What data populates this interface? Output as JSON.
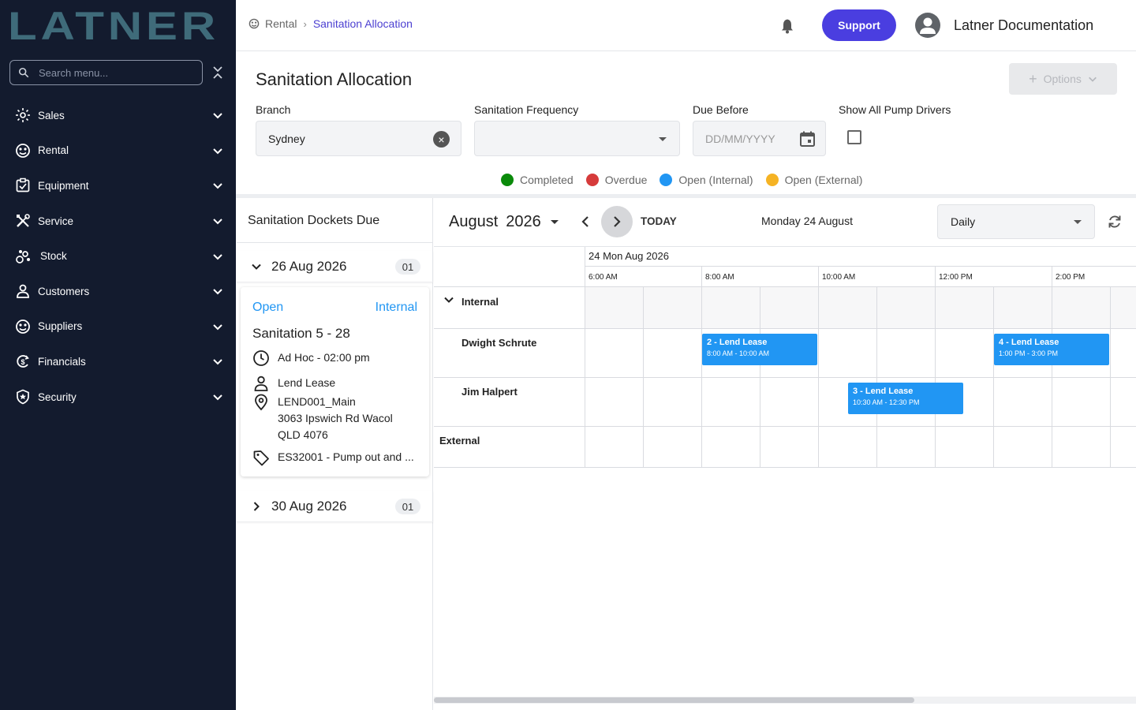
{
  "sidebar": {
    "logo_text": "LATNER",
    "search_placeholder": "Search menu...",
    "items": [
      {
        "label": "Sales",
        "icon": "sales-icon"
      },
      {
        "label": "Rental",
        "icon": "rental-icon"
      },
      {
        "label": "Equipment",
        "icon": "equipment-icon"
      },
      {
        "label": "Service",
        "icon": "service-icon"
      },
      {
        "label": "Stock",
        "icon": "stock-icon"
      },
      {
        "label": "Customers",
        "icon": "customers-icon"
      },
      {
        "label": "Suppliers",
        "icon": "suppliers-icon"
      },
      {
        "label": "Financials",
        "icon": "financials-icon"
      },
      {
        "label": "Security",
        "icon": "security-icon"
      }
    ]
  },
  "header": {
    "breadcrumb": [
      "Rental",
      "Sanitation Allocation"
    ],
    "support_label": "Support",
    "user_name": "Latner Documentation"
  },
  "page": {
    "title": "Sanitation Allocation",
    "options_label": "Options"
  },
  "filters": {
    "branch_label": "Branch",
    "branch_value": "Sydney",
    "frequency_label": "Sanitation Frequency",
    "frequency_value": "",
    "due_before_label": "Due Before",
    "due_before_placeholder": "DD/MM/YYYY",
    "show_all_label": "Show All Pump Drivers",
    "show_all_checked": false
  },
  "legend": [
    {
      "label": "Completed",
      "color": "#0a8a0a"
    },
    {
      "label": "Overdue",
      "color": "#d63b3b"
    },
    {
      "label": "Open (Internal)",
      "color": "#2196f3"
    },
    {
      "label": "Open (External)",
      "color": "#f5b324"
    }
  ],
  "dockets": {
    "title": "Sanitation Dockets Due",
    "groups": [
      {
        "date": "26 Aug 2026",
        "count": "01",
        "expanded": true
      },
      {
        "date": "30 Aug 2026",
        "count": "01",
        "expanded": false
      }
    ],
    "card": {
      "status": "Open",
      "type": "Internal",
      "name": "Sanitation 5 - 28",
      "schedule": "Ad Hoc - 02:00 pm",
      "customer": "Lend Lease",
      "site": "LEND001_Main",
      "address_line1": "3063 Ipswich Rd Wacol",
      "address_line2": "QLD 4076",
      "item": "ES32001 - Pump out and ..."
    }
  },
  "calendar": {
    "month": "August",
    "year": "2026",
    "today_label": "TODAY",
    "current_date": "Monday 24 August",
    "view": "Daily",
    "day_header": "24 Mon Aug 2026",
    "time_labels": [
      "6:00 AM",
      "8:00 AM",
      "10:00 AM",
      "12:00 PM",
      "2:00 PM"
    ],
    "groups": [
      "Internal",
      "External"
    ],
    "resources": [
      "Dwight Schrute",
      "Jim Halpert"
    ],
    "events": [
      {
        "title": "2 - Lend Lease",
        "time": "8:00 AM - 10:00 AM",
        "resource": "Dwight Schrute"
      },
      {
        "title": "4 - Lend Lease",
        "time": "1:00 PM - 3:00 PM",
        "resource": "Dwight Schrute"
      },
      {
        "title": "3 - Lend Lease",
        "time": "10:30 AM - 12:30 PM",
        "resource": "Jim Halpert"
      }
    ],
    "event_color": "#2196f3"
  }
}
